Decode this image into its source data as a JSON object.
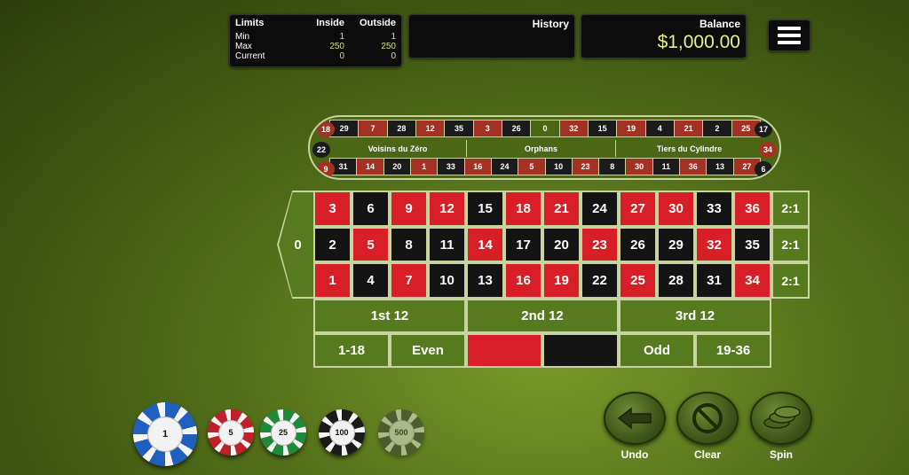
{
  "limits": {
    "title": "Limits",
    "col_inside": "Inside",
    "col_outside": "Outside",
    "rows": [
      {
        "label": "Min",
        "inside": "1",
        "outside": "1"
      },
      {
        "label": "Max",
        "inside": "250",
        "outside": "250"
      },
      {
        "label": "Current",
        "inside": "0",
        "outside": "0"
      }
    ]
  },
  "history": {
    "title": "History"
  },
  "balance": {
    "title": "Balance",
    "amount": "$1,000.00"
  },
  "menu": {
    "icon": "hamburger-menu-icon"
  },
  "racetrack": {
    "top": [
      {
        "n": "29",
        "c": "black"
      },
      {
        "n": "7",
        "c": "red"
      },
      {
        "n": "28",
        "c": "black"
      },
      {
        "n": "12",
        "c": "red"
      },
      {
        "n": "35",
        "c": "black"
      },
      {
        "n": "3",
        "c": "red"
      },
      {
        "n": "26",
        "c": "black"
      },
      {
        "n": "0",
        "c": "green"
      },
      {
        "n": "32",
        "c": "red"
      },
      {
        "n": "15",
        "c": "black"
      },
      {
        "n": "19",
        "c": "red"
      },
      {
        "n": "4",
        "c": "black"
      },
      {
        "n": "21",
        "c": "red"
      },
      {
        "n": "2",
        "c": "black"
      },
      {
        "n": "25",
        "c": "red"
      }
    ],
    "bottom": [
      {
        "n": "31",
        "c": "black"
      },
      {
        "n": "14",
        "c": "red"
      },
      {
        "n": "20",
        "c": "black"
      },
      {
        "n": "1",
        "c": "red"
      },
      {
        "n": "33",
        "c": "black"
      },
      {
        "n": "16",
        "c": "red"
      },
      {
        "n": "24",
        "c": "black"
      },
      {
        "n": "5",
        "c": "red"
      },
      {
        "n": "10",
        "c": "black"
      },
      {
        "n": "23",
        "c": "red"
      },
      {
        "n": "8",
        "c": "black"
      },
      {
        "n": "30",
        "c": "red"
      },
      {
        "n": "11",
        "c": "black"
      },
      {
        "n": "36",
        "c": "red"
      },
      {
        "n": "13",
        "c": "black"
      },
      {
        "n": "27",
        "c": "red"
      }
    ],
    "left_side": [
      {
        "n": "18",
        "c": "red"
      },
      {
        "n": "22",
        "c": "black"
      },
      {
        "n": "9",
        "c": "red"
      }
    ],
    "right_side": [
      {
        "n": "17",
        "c": "black"
      },
      {
        "n": "34",
        "c": "red"
      },
      {
        "n": "6",
        "c": "black"
      }
    ],
    "sectors": [
      "Voisins du Zéro",
      "Orphans",
      "Tiers du Cylindre"
    ]
  },
  "table": {
    "zero": "0",
    "rows": [
      [
        {
          "n": "3",
          "c": "red"
        },
        {
          "n": "6",
          "c": "black"
        },
        {
          "n": "9",
          "c": "red"
        },
        {
          "n": "12",
          "c": "red"
        },
        {
          "n": "15",
          "c": "black"
        },
        {
          "n": "18",
          "c": "red"
        },
        {
          "n": "21",
          "c": "red"
        },
        {
          "n": "24",
          "c": "black"
        },
        {
          "n": "27",
          "c": "red"
        },
        {
          "n": "30",
          "c": "red"
        },
        {
          "n": "33",
          "c": "black"
        },
        {
          "n": "36",
          "c": "red"
        }
      ],
      [
        {
          "n": "2",
          "c": "black"
        },
        {
          "n": "5",
          "c": "red"
        },
        {
          "n": "8",
          "c": "black"
        },
        {
          "n": "11",
          "c": "black"
        },
        {
          "n": "14",
          "c": "red"
        },
        {
          "n": "17",
          "c": "black"
        },
        {
          "n": "20",
          "c": "black"
        },
        {
          "n": "23",
          "c": "red"
        },
        {
          "n": "26",
          "c": "black"
        },
        {
          "n": "29",
          "c": "black"
        },
        {
          "n": "32",
          "c": "red"
        },
        {
          "n": "35",
          "c": "black"
        }
      ],
      [
        {
          "n": "1",
          "c": "red"
        },
        {
          "n": "4",
          "c": "black"
        },
        {
          "n": "7",
          "c": "red"
        },
        {
          "n": "10",
          "c": "black"
        },
        {
          "n": "13",
          "c": "black"
        },
        {
          "n": "16",
          "c": "red"
        },
        {
          "n": "19",
          "c": "red"
        },
        {
          "n": "22",
          "c": "black"
        },
        {
          "n": "25",
          "c": "red"
        },
        {
          "n": "28",
          "c": "black"
        },
        {
          "n": "31",
          "c": "black"
        },
        {
          "n": "34",
          "c": "red"
        }
      ]
    ],
    "column_bets": [
      "2:1",
      "2:1",
      "2:1"
    ],
    "dozens": [
      "1st 12",
      "2nd 12",
      "3rd 12"
    ],
    "outside": [
      {
        "label": "1-18",
        "kind": "text"
      },
      {
        "label": "Even",
        "kind": "text"
      },
      {
        "label": "",
        "kind": "red"
      },
      {
        "label": "",
        "kind": "black"
      },
      {
        "label": "Odd",
        "kind": "text"
      },
      {
        "label": "19-36",
        "kind": "text"
      }
    ]
  },
  "chips": [
    {
      "value": "1",
      "color": "#1f5fbf",
      "selected": true
    },
    {
      "value": "5",
      "color": "#c0202a",
      "selected": false
    },
    {
      "value": "25",
      "color": "#1e8a3a",
      "selected": false
    },
    {
      "value": "100",
      "color": "#1a1a1a",
      "selected": false
    },
    {
      "value": "500",
      "color": "#3a3a3a",
      "selected": false,
      "disabled": true
    }
  ],
  "actions": [
    {
      "label": "Undo",
      "icon": "undo-arrow-icon"
    },
    {
      "label": "Clear",
      "icon": "clear-prohibited-icon"
    },
    {
      "label": "Spin",
      "icon": "spin-chips-icon"
    }
  ],
  "colors": {
    "red": "#d81f27",
    "black": "#141414",
    "felt": "#587a1e",
    "line": "#c7d4a0",
    "balance_text": "#e8ef8a"
  }
}
